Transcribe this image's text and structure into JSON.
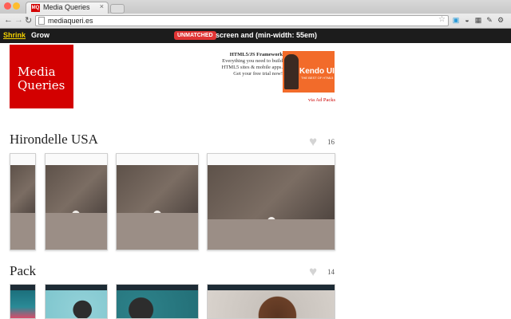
{
  "browser": {
    "tab_title": "Media Queries",
    "favicon_text": "MQ",
    "url": "mediaqueri.es"
  },
  "appbar": {
    "shrink_label": "Shrink",
    "grow_label": "Grow",
    "status_badge": "UNMATCHED",
    "query_text": "screen and (min-width: 55em)"
  },
  "header": {
    "logo_line1": "Media",
    "logo_line2": "Queries",
    "ad_title": "HTML5/JS Framework",
    "ad_text": "Everything you need to build HTML5 sites & mobile apps. Get your free trial now!",
    "ad_brand": "Kendo UI",
    "ad_brand_sub": "THE BEST OF HTML5",
    "ad_via": "via Ad Packs"
  },
  "sites": [
    {
      "name": "Hirondelle USA",
      "likes": "16"
    },
    {
      "name": "Pack",
      "likes": "14"
    }
  ],
  "colors": {
    "accent_red": "#d30000",
    "appbar_bg": "#1c1c1c",
    "shrink_yellow": "#f5d300",
    "badge_red": "#e03434"
  }
}
